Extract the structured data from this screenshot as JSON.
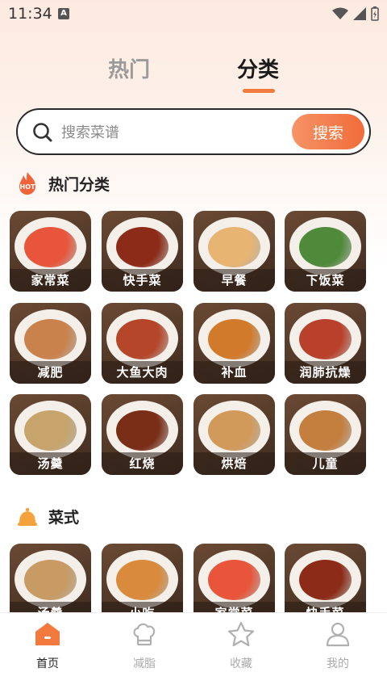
{
  "status_bar": {
    "time": "11:34",
    "notif_letter": "A"
  },
  "top_tabs": {
    "hot": "热门",
    "category": "分类"
  },
  "search": {
    "placeholder": "搜索菜谱",
    "button": "搜索"
  },
  "hot_categories": {
    "badge": "HOT",
    "title": "热门分类",
    "items": [
      {
        "label": "家常菜",
        "color": "#e8553a"
      },
      {
        "label": "快手菜",
        "color": "#8c2c18"
      },
      {
        "label": "早餐",
        "color": "#e7b472"
      },
      {
        "label": "下饭菜",
        "color": "#4f8a3a"
      },
      {
        "label": "减肥",
        "color": "#c9824c"
      },
      {
        "label": "大鱼大肉",
        "color": "#b5462a"
      },
      {
        "label": "补血",
        "color": "#d27a2c"
      },
      {
        "label": "润肺抗燥",
        "color": "#b9402b"
      },
      {
        "label": "汤羹",
        "color": "#c6a46c"
      },
      {
        "label": "红烧",
        "color": "#7a2e18"
      },
      {
        "label": "烘焙",
        "color": "#d19a5a"
      },
      {
        "label": "儿童",
        "color": "#c47e3e"
      }
    ]
  },
  "dish_styles": {
    "title": "菜式",
    "items": [
      {
        "label": "汤羹",
        "color": "#c89a64"
      },
      {
        "label": "小吃",
        "color": "#d98a3c"
      },
      {
        "label": "家常菜",
        "color": "#e8553a"
      },
      {
        "label": "快手菜",
        "color": "#8c2c18"
      }
    ]
  },
  "bottom_nav": [
    {
      "label": "首页",
      "icon": "home-icon",
      "active": true
    },
    {
      "label": "减脂",
      "icon": "chef-hat-icon",
      "active": false
    },
    {
      "label": "收藏",
      "icon": "star-icon",
      "active": false
    },
    {
      "label": "我的",
      "icon": "person-icon",
      "active": false
    }
  ],
  "colors": {
    "accent": "#f26c3a"
  }
}
